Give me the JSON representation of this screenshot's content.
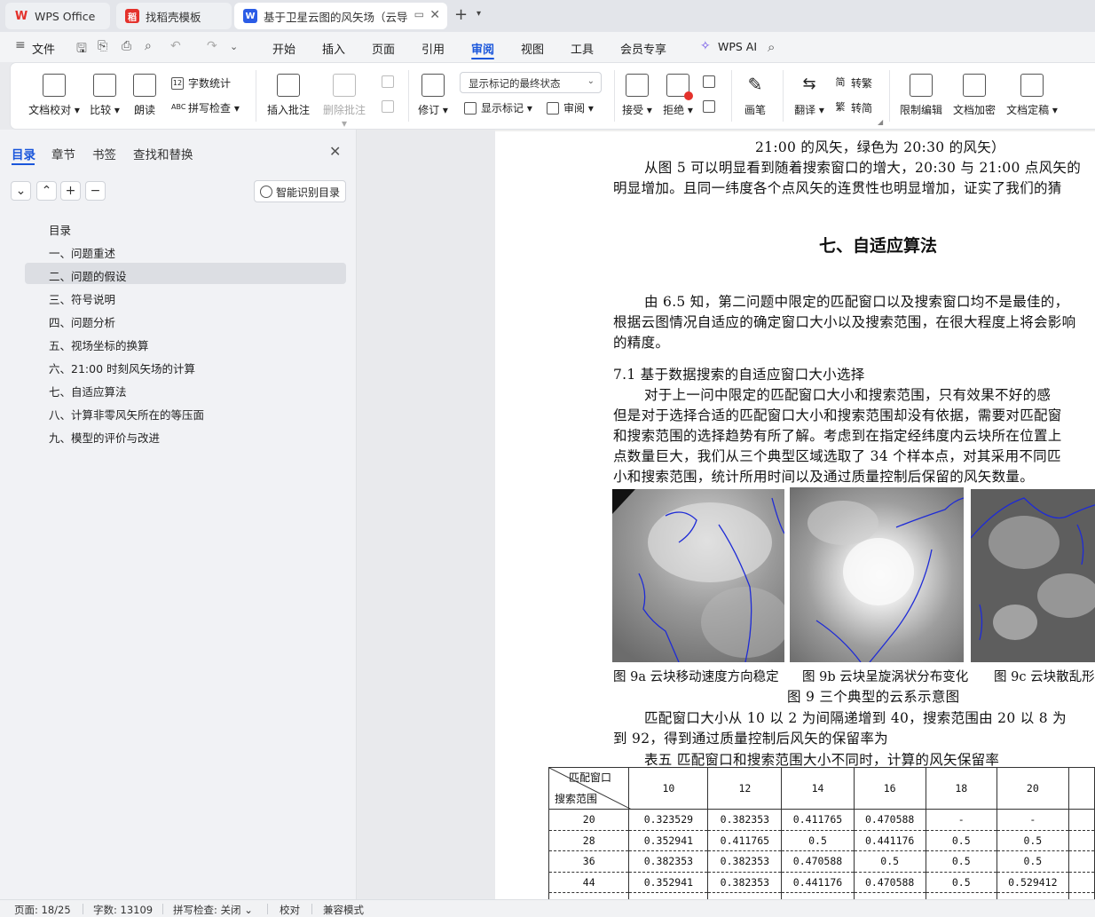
{
  "tabs": [
    {
      "label": "WPS Office"
    },
    {
      "label": "找稻壳模板"
    },
    {
      "label": "基于卫星云图的风矢场（云导"
    }
  ],
  "menu": {
    "file": "文件",
    "items": [
      "开始",
      "插入",
      "页面",
      "引用",
      "审阅",
      "视图",
      "工具",
      "会员专享"
    ],
    "active": "审阅",
    "ai": "WPS AI"
  },
  "ribbon": {
    "doc_check": "文档校对",
    "compare": "比较",
    "read_aloud": "朗读",
    "word_count": "字数统计",
    "spell_check": "拼写检查",
    "insert_comment": "插入批注",
    "delete_comment": "删除批注",
    "revise": "修订",
    "markup_state": "显示标记的最终状态",
    "show_markup": "显示标记",
    "review": "审阅",
    "accept": "接受",
    "reject": "拒绝",
    "pen": "画笔",
    "translate": "翻译",
    "to_traditional": "转繁",
    "to_simplified": "转简",
    "restrict_edit": "限制编辑",
    "encrypt": "文档加密",
    "finalize": "文档定稿"
  },
  "nav": {
    "tabs": [
      "目录",
      "章节",
      "书签",
      "查找和替换"
    ],
    "smart_toc": "智能识别目录",
    "toc": [
      "目录",
      "一、问题重述",
      "二、问题的假设",
      "三、符号说明",
      "四、问题分析",
      "五、视场坐标的换算",
      "六、21:00 时刻风矢场的计算",
      "七、自适应算法",
      "八、计算非零风矢所在的等压面",
      "九、模型的评价与改进"
    ]
  },
  "doc": {
    "l1": "21:00 的风矢，绿色为 20:30 的风矢）",
    "l2": "从图 5 可以明显看到随着搜索窗口的增大，20:30 与 21:00 点风矢的",
    "l3": "明显增加。且同一纬度各个点风矢的连贯性也明显增加，证实了我们的猜",
    "heading": "七、自适应算法",
    "p1a": "由 6.5 知，第二问题中限定的匹配窗口以及搜索窗口均不是最佳的，",
    "p1b": "根据云图情况自适应的确定窗口大小以及搜索范围，在很大程度上将会影响",
    "p1c": "的精度。",
    "sub": "7.1  基于数据搜索的自适应窗口大小选择",
    "p2a": "对于上一问中限定的匹配窗口大小和搜索范围，只有效果不好的感",
    "p2b": "但是对于选择合适的匹配窗口大小和搜索范围却没有依据，需要对匹配窗",
    "p2c": "和搜索范围的选择趋势有所了解。考虑到在指定经纬度内云块所在位置上",
    "p2d": "点数量巨大，我们从三个典型区域选取了 34 个样本点，对其采用不同匹",
    "p2e": "小和搜索范围，统计所用时间以及通过质量控制后保留的风矢数量。",
    "cap_a": "图 9a  云块移动速度方向稳定",
    "cap_b": "图 9b 云块呈旋涡状分布变化",
    "cap_c": "图 9c 云块散乱形",
    "fig_title": "图 9  三个典型的云系示意图",
    "p3a": "匹配窗口大小从 10 以 2 为间隔递增到 40，搜索范围由 20 以 8 为",
    "p3b": "到 92，得到通过质量控制后风矢的保留率为",
    "table_title": "表五  匹配窗口和搜索范围大小不同时，计算的风矢保留率",
    "table": {
      "corner_top": "匹配窗口",
      "corner_bottom": "搜索范围",
      "cols": [
        "10",
        "12",
        "14",
        "16",
        "18",
        "20"
      ],
      "rows": [
        {
          "k": "20",
          "v": [
            "0.323529",
            "0.382353",
            "0.411765",
            "0.470588",
            "-",
            "-"
          ]
        },
        {
          "k": "28",
          "v": [
            "0.352941",
            "0.411765",
            "0.5",
            "0.441176",
            "0.5",
            "0.5"
          ]
        },
        {
          "k": "36",
          "v": [
            "0.382353",
            "0.382353",
            "0.470588",
            "0.5",
            "0.5",
            "0.5"
          ]
        },
        {
          "k": "44",
          "v": [
            "0.352941",
            "0.382353",
            "0.441176",
            "0.470588",
            "0.5",
            "0.529412"
          ]
        }
      ]
    }
  },
  "status": {
    "page": "页面: 18/25",
    "words": "字数: 13109",
    "spell": "拼写检查: 关闭",
    "proof": "校对",
    "compat": "兼容模式"
  }
}
